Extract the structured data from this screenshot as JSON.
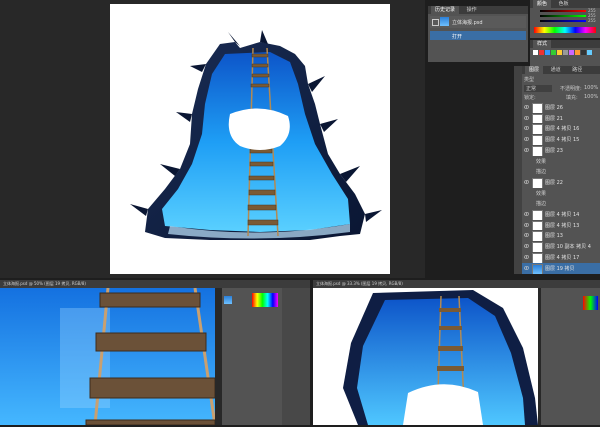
{
  "history": {
    "tabs": [
      "历史记录",
      "操作"
    ],
    "file": "立体海报.psd",
    "step": "打开"
  },
  "color": {
    "tabs": [
      "颜色",
      "色板"
    ],
    "r": "255",
    "g": "255",
    "b": "255"
  },
  "swatches_title": "样式",
  "layers": {
    "tabs": [
      "图层",
      "通道",
      "路径"
    ],
    "kind_label": "类型",
    "blend_mode": "正常",
    "opacity_label": "不透明度:",
    "opacity": "100%",
    "lock_label": "锁定:",
    "fill_label": "填充:",
    "fill": "100%",
    "items": [
      {
        "name": "图层 26",
        "thumb": "white"
      },
      {
        "name": "图层 21",
        "thumb": "white"
      },
      {
        "name": "图层 4 拷贝 16",
        "thumb": "white"
      },
      {
        "name": "图层 4 拷贝 15",
        "thumb": "white"
      },
      {
        "name": "图层 23",
        "thumb": "white"
      },
      {
        "name": "效果",
        "thumb": "fx"
      },
      {
        "name": "描边",
        "thumb": "fx"
      },
      {
        "name": "图层 22",
        "thumb": "white"
      },
      {
        "name": "效果",
        "thumb": "fx"
      },
      {
        "name": "描边",
        "thumb": "fx"
      },
      {
        "name": "图层 4 拷贝 14",
        "thumb": "white"
      },
      {
        "name": "图层 4 拷贝 13",
        "thumb": "white"
      },
      {
        "name": "图层 13",
        "thumb": "white"
      },
      {
        "name": "图层 10 副本 拷贝 4",
        "thumb": "white"
      },
      {
        "name": "图层 4 拷贝 17",
        "thumb": "white"
      },
      {
        "name": "图层 19 拷贝",
        "thumb": "blue"
      }
    ]
  },
  "bottom_left_title": "立体海报.psd @ 50% (图层 19 拷贝, RGB/8)",
  "bottom_right_title": "立体海报.psd @ 33.3% (图层 19 拷贝, RGB/8)"
}
